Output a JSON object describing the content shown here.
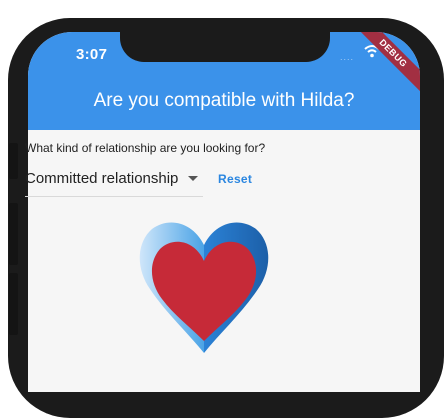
{
  "status_bar": {
    "time": "3:07",
    "signal": "....",
    "debug_banner": "DEBUG"
  },
  "app_bar": {
    "title": "Are you compatible with Hilda?",
    "color": "#3b92ea"
  },
  "form": {
    "question": "What kind of relationship are you looking for?",
    "relationship_select": {
      "value": "Committed relationship"
    },
    "reset_label": "Reset"
  },
  "icons": [
    "wifi-icon",
    "chevron-down-icon",
    "heart-icon"
  ],
  "colors": {
    "accent": "#2a86e0",
    "heart_inner": "#c62a38",
    "heart_outer": "#4aa3e6"
  }
}
